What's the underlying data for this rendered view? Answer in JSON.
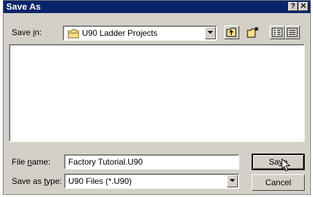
{
  "window": {
    "title": "Save As"
  },
  "titlebar": {
    "help_label": "?",
    "close_label": "✕"
  },
  "save_in": {
    "label_pre": "Save ",
    "label_key": "i",
    "label_post": "n:",
    "value": "U90 Ladder Projects"
  },
  "file_name": {
    "label_pre": "File ",
    "label_key": "n",
    "label_post": "ame:",
    "value": "Factory Tutorial.U90"
  },
  "save_as_type": {
    "label_pre": "Save as ",
    "label_key": "t",
    "label_post": "ype:",
    "value": "U90 Files (*.U90)"
  },
  "buttons": {
    "save_pre": "Sa",
    "save_key": "v",
    "save_post": "e",
    "cancel": "Cancel"
  },
  "icons": {
    "folder": "folder-icon",
    "up_folder": "up-folder-icon",
    "new_folder": "new-folder-icon",
    "list_view": "list-view-icon",
    "details_view": "details-view-icon",
    "cursor": "mouse-cursor-icon"
  }
}
